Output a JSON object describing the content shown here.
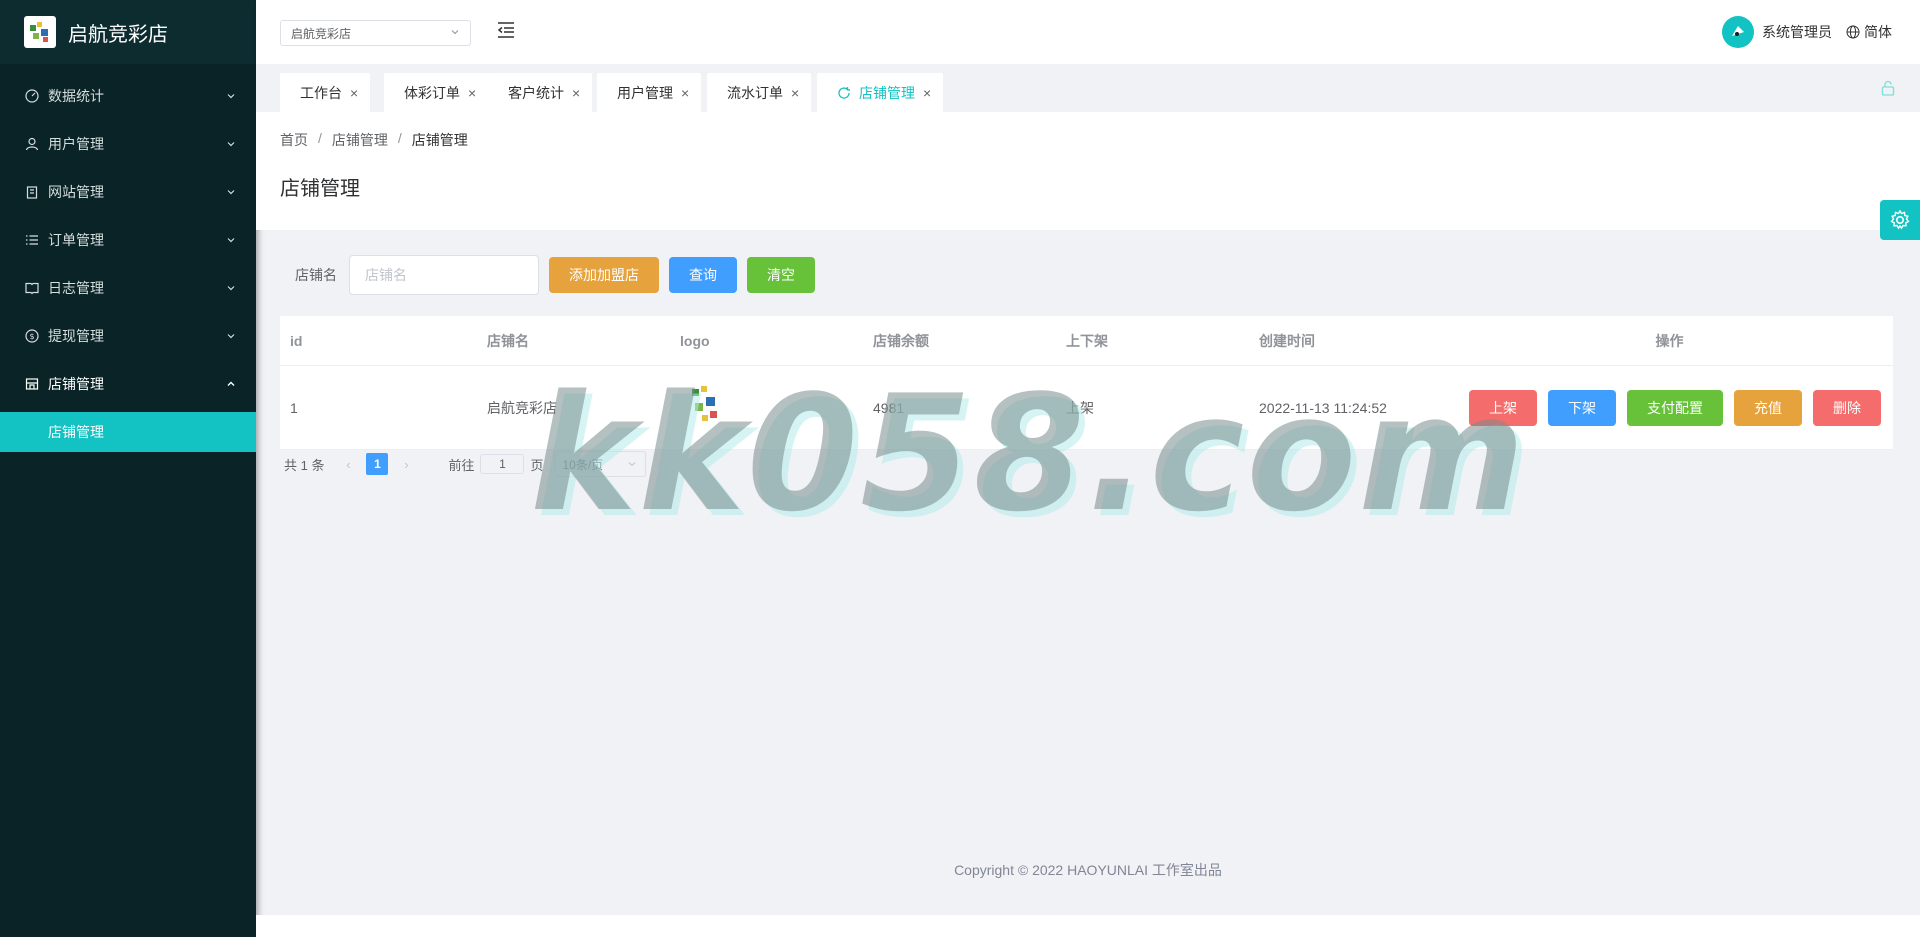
{
  "brand": {
    "title": "启航竞彩店"
  },
  "sidebar": {
    "items": [
      {
        "label": "数据统计",
        "icon": "dashboard-icon"
      },
      {
        "label": "用户管理",
        "icon": "user-icon"
      },
      {
        "label": "网站管理",
        "icon": "clipboard-icon"
      },
      {
        "label": "订单管理",
        "icon": "list-icon"
      },
      {
        "label": "日志管理",
        "icon": "book-icon"
      },
      {
        "label": "提现管理",
        "icon": "coin-icon"
      },
      {
        "label": "店铺管理",
        "icon": "shop-icon"
      }
    ],
    "subitem": "店铺管理"
  },
  "header": {
    "shop_select": "启航竞彩店",
    "user_name": "系统管理员",
    "lang": "简体"
  },
  "tabs": [
    "工作台",
    "体彩订单",
    "客户统计",
    "用户管理",
    "流水订单",
    "店铺管理"
  ],
  "breadcrumb": [
    "首页",
    "店铺管理",
    "店铺管理"
  ],
  "page_title": "店铺管理",
  "search": {
    "label": "店铺名",
    "placeholder": "店铺名",
    "add_label": "添加加盟店",
    "query_label": "查询",
    "clear_label": "清空"
  },
  "table": {
    "headers": [
      "id",
      "店铺名",
      "logo",
      "店铺余额",
      "上下架",
      "创建时间",
      "操作"
    ],
    "rows": [
      {
        "id": "1",
        "name": "启航竞彩店",
        "balance": "4981",
        "status": "上架",
        "created": "2022-11-13 11:24:52"
      }
    ],
    "actions": [
      "上架",
      "下架",
      "支付配置",
      "充值",
      "删除"
    ]
  },
  "pager": {
    "total": "共 1 条",
    "current": "1",
    "goto_prefix": "前往",
    "goto_value": "1",
    "goto_suffix": "页",
    "page_size": "10条/页"
  },
  "footer": {
    "copyright": "Copyright © 2022 HAOYUNLAI 工作室出品"
  },
  "watermark": "kk058.com",
  "colors": {
    "accent": "#13c2c2",
    "sidebar": "#0a2326",
    "primary": "#409eff",
    "warning": "#e6a23c",
    "success": "#67c23a",
    "danger": "#f56c6c"
  }
}
